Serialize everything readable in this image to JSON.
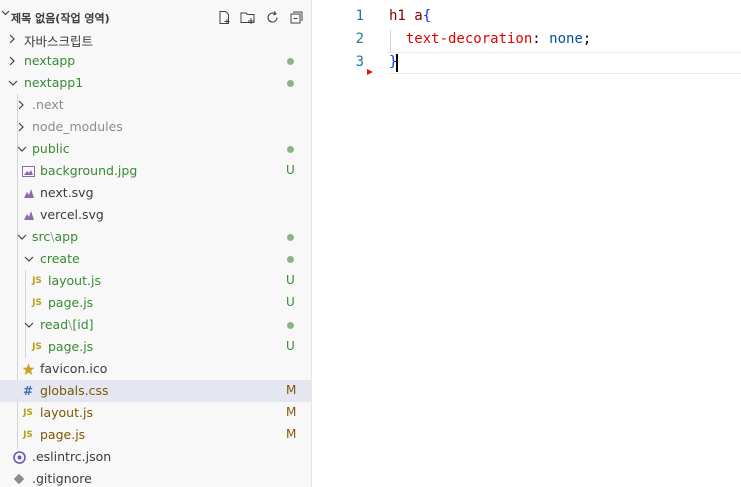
{
  "explorer": {
    "title": "제목 없음(작업 영역)",
    "actions": [
      "new-file-icon",
      "new-folder-icon",
      "refresh-icon",
      "collapse-all-icon"
    ],
    "items": [
      {
        "label": "자바스크립트",
        "badge": ""
      },
      {
        "label": "nextapp",
        "badge": ""
      },
      {
        "label": "nextapp1",
        "badge": ""
      },
      {
        "label": ".next",
        "badge": ""
      },
      {
        "label": "node_modules",
        "badge": ""
      },
      {
        "label": "public",
        "badge": ""
      },
      {
        "label": "background.jpg",
        "badge": "U"
      },
      {
        "label": "next.svg",
        "badge": ""
      },
      {
        "label": "vercel.svg",
        "badge": ""
      },
      {
        "label": "src",
        "sublabel": "app",
        "badge": ""
      },
      {
        "label": "create",
        "badge": ""
      },
      {
        "label": "layout.js",
        "badge": "U"
      },
      {
        "label": "page.js",
        "badge": "U"
      },
      {
        "label": "read",
        "sublabel": "[id]",
        "badge": ""
      },
      {
        "label": "page.js",
        "badge": "U"
      },
      {
        "label": "favicon.ico",
        "badge": ""
      },
      {
        "label": "globals.css",
        "badge": "M"
      },
      {
        "label": "layout.js",
        "badge": "M"
      },
      {
        "label": "page.js",
        "badge": "M"
      },
      {
        "label": ".eslintrc.json",
        "badge": ""
      },
      {
        "label": ".gitignore",
        "badge": ""
      }
    ],
    "path_separator": "\\"
  },
  "editor": {
    "line_numbers": [
      "1",
      "2",
      "3"
    ],
    "code": {
      "l1_selector": "h1 a",
      "l1_brace": "{",
      "l2_property": "text-decoration",
      "l2_colon": ": ",
      "l2_value": "none",
      "l2_semi": ";",
      "l3_brace": "}"
    }
  },
  "colors": {
    "untracked": "#388a34",
    "modified": "#895503",
    "selected_row": "#e4e6f1",
    "line_number": "#237893"
  }
}
